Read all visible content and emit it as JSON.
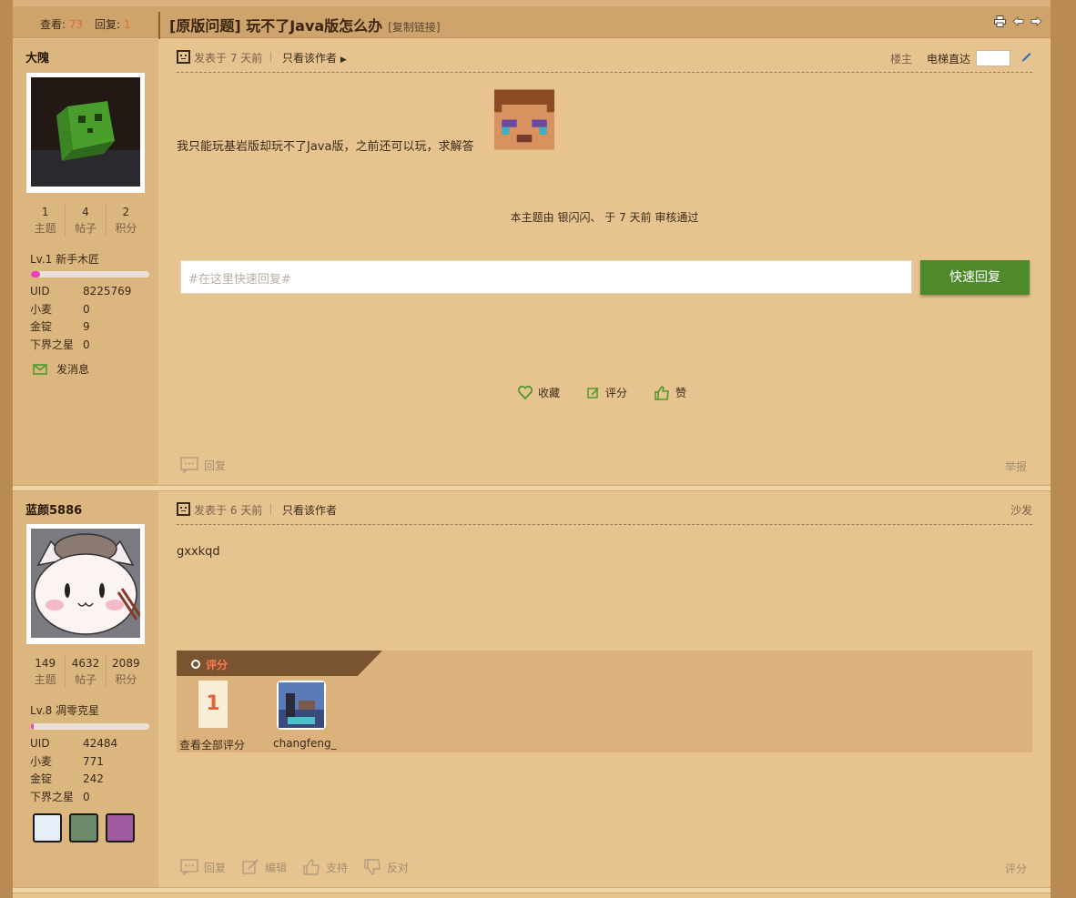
{
  "header": {
    "views_label": "查看:",
    "views": "73",
    "replies_label": "回复:",
    "replies": "1",
    "title": "[原版问题] 玩不了Java版怎么办",
    "copy_link": "[复制链接]"
  },
  "posts": [
    {
      "user": {
        "name": "大隗",
        "topics": "1",
        "topics_label": "主题",
        "posts": "4",
        "posts_label": "帖子",
        "points": "2",
        "points_label": "积分",
        "level": "Lv.1 新手木匠",
        "level_progress": 0.08,
        "uid_label": "UID",
        "uid": "8225769",
        "wheat_label": "小麦",
        "wheat": "0",
        "gold_label": "金锭",
        "gold": "9",
        "nether_label": "下界之星",
        "nether": "0",
        "message": "发消息"
      },
      "time": "发表于 7 天前",
      "only_author": "只看该作者",
      "floor": "楼主",
      "elevator": "电梯直达",
      "body": "我只能玩基岩版却玩不了Java版，之前还可以玩，求解答",
      "review": "本主题由 银闪闪、 于 7 天前 审核通过",
      "quick_reply_placeholder": "#在这里快速回复#",
      "quick_reply_button": "快速回复",
      "actions": {
        "favorite": "收藏",
        "rate": "评分",
        "like": "赞"
      },
      "footer": {
        "reply": "回复",
        "report": "举报"
      }
    },
    {
      "user": {
        "name": "蓝颜5886",
        "topics": "149",
        "topics_label": "主题",
        "posts": "4632",
        "posts_label": "帖子",
        "points": "2089",
        "points_label": "积分",
        "level": "Lv.8 凋零克星",
        "level_progress": 0.02,
        "uid_label": "UID",
        "uid": "42484",
        "wheat_label": "小麦",
        "wheat": "771",
        "gold_label": "金锭",
        "gold": "242",
        "nether_label": "下界之星",
        "nether": "0"
      },
      "time": "发表于 6 天前",
      "only_author": "只看该作者",
      "floor": "沙发",
      "body": "gxxkqd",
      "rating": {
        "title": "评分",
        "count": "1",
        "view_all": "查看全部评分",
        "rater": "changfeng_"
      },
      "footer": {
        "reply": "回复",
        "edit": "编辑",
        "support": "支持",
        "oppose": "反对",
        "rate": "评分"
      }
    }
  ],
  "colors": {
    "accent": "#4e8a2c",
    "count": "#e06a40",
    "level_bar": "#ef3fb7"
  },
  "icons": [
    "print-icon",
    "prev-icon",
    "next-icon",
    "pen-icon",
    "mail-icon",
    "heart-icon",
    "edit-icon",
    "thumb-up-icon",
    "thumb-down-icon",
    "reply-icon"
  ]
}
